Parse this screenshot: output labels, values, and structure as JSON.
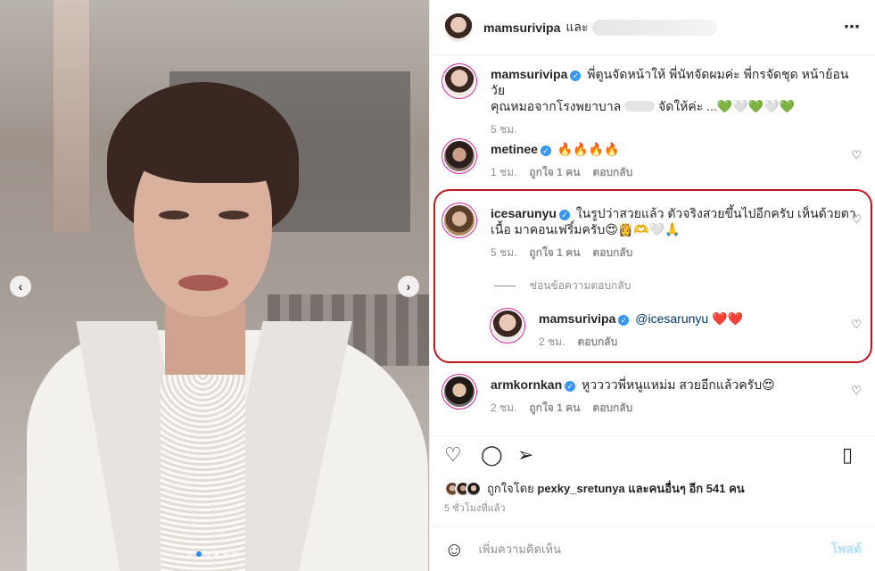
{
  "header": {
    "username": "mamsurivipa",
    "and_text": "และ",
    "more_icon": "⋯"
  },
  "photo": {
    "prev_icon": "‹",
    "next_icon": "›"
  },
  "caption": {
    "username": "mamsurivipa",
    "text_line1": "พี่ตูนจัดหน้าให้ พี่นัทจัดผมค่ะ พี่กรจัดชุด หน้าย้อนวัย",
    "text_line2a": "คุณหมอจากโรงพยาบาล",
    "text_line2b": "จัดให้ค่ะ ...💚🤍💚🤍💚",
    "time": "5 ชม."
  },
  "comments": [
    {
      "username": "metinee",
      "text": "🔥🔥🔥🔥",
      "time": "1 ชม.",
      "likes": "ถูกใจ 1 คน",
      "reply": "ตอบกลับ"
    },
    {
      "username": "icesarunyu",
      "text_line1": "ในรูปว่าสวยแล้ว ตัวจริงสวยขึ้นไปอีกครับ เห็นด้วยตา",
      "text_line2": "เนื้อ มาคอนเฟริ์มครับ😍👸🫶🤍🙏",
      "time": "5 ชม.",
      "likes": "ถูกใจ 1 คน",
      "reply": "ตอบกลับ"
    },
    {
      "username": "armkornkan",
      "text": "หูววววพี่หนูแหม่ม สวยอีกแล้วครับ😍",
      "time": "2 ชม.",
      "likes": "ถูกใจ 1 คน",
      "reply": "ตอบกลับ"
    }
  ],
  "hide_replies": "ซ่อนข้อความตอบกลับ",
  "reply": {
    "username": "mamsurivipa",
    "mention": "@icesarunyu",
    "text": " ❤️❤️",
    "time": "2 ชม.",
    "reply": "ตอบกลับ"
  },
  "likes": {
    "prefix": "ถูกใจโดย",
    "user": "pexky_sretunya",
    "suffix": "และคนอื่นๆ อีก 541 คน"
  },
  "post_time": "5 ชั่วโมงที่แล้ว",
  "add_comment": {
    "placeholder": "เพิ่มความคิดเห็น",
    "post": "โพสต์"
  },
  "icons": {
    "heart": "♡",
    "comment": "◯",
    "share": "➢",
    "save": "▯",
    "emoji": "☺",
    "verified": "✓"
  },
  "colors": {
    "highlight": "#c0161f",
    "verified": "#3897f0",
    "post_button": "#b2dffc"
  }
}
